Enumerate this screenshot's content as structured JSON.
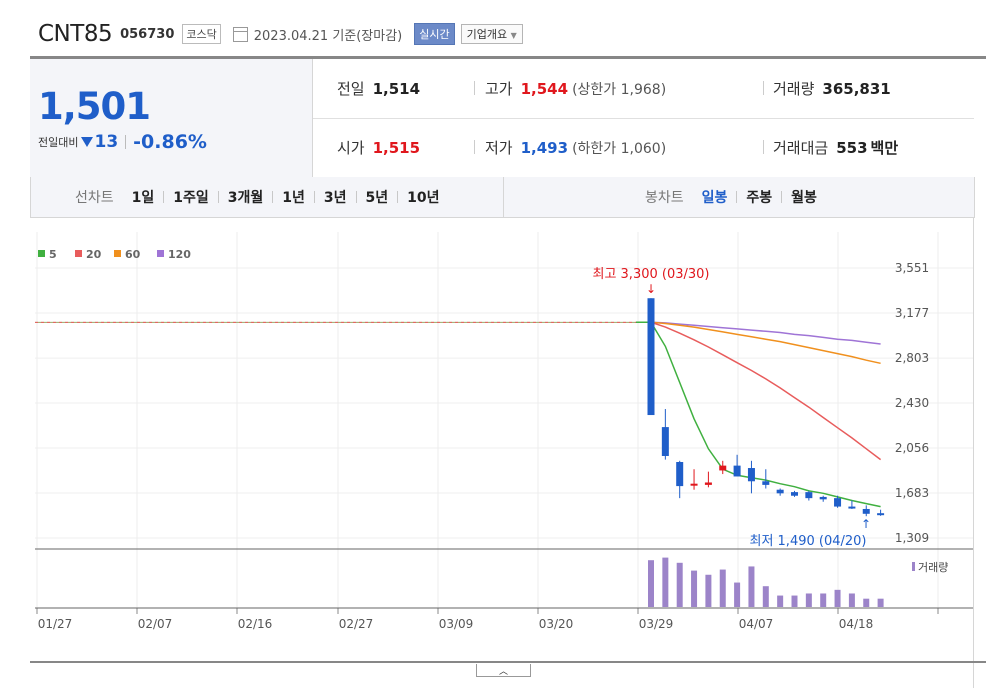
{
  "header": {
    "name": "CNT85",
    "code": "056730",
    "market": "코스닥",
    "date": "2023.04.21 기준(장마감)",
    "realtime": "실시간",
    "company": "기업개요"
  },
  "price": {
    "current": "1,501",
    "change_label": "전일대비",
    "change": "13",
    "change_direction": "down",
    "change_pct": "-0.86%"
  },
  "quote": {
    "prev": {
      "label": "전일",
      "value": "1,514"
    },
    "open": {
      "label": "시가",
      "value": "1,515"
    },
    "high": {
      "label": "고가",
      "value": "1,544",
      "extra": "(상한가 1,968)"
    },
    "low": {
      "label": "저가",
      "value": "1,493",
      "extra": "(하한가 1,060)"
    },
    "volume": {
      "label": "거래량",
      "value": "365,831"
    },
    "amount": {
      "label": "거래대금",
      "value": "553",
      "unit": "백만"
    }
  },
  "tabs": {
    "line_label": "선차트",
    "line": [
      "1일",
      "1주일",
      "3개월",
      "1년",
      "3년",
      "5년",
      "10년"
    ],
    "candle_label": "봉차트",
    "candle": [
      "일봉",
      "주봉",
      "월봉"
    ],
    "candle_active": 0
  },
  "colors": {
    "up": "#e0171d",
    "down": "#1f5ec9",
    "ma5": "#40b040",
    "ma20": "#e85c5c",
    "ma60": "#f0901e",
    "ma120": "#9f74d6",
    "volume": "#9c84c9"
  },
  "chart_data": {
    "type": "candlestick",
    "legend": [
      "5",
      "20",
      "60",
      "120"
    ],
    "y_ticks": [
      "3,551",
      "3,177",
      "2,803",
      "2,430",
      "2,056",
      "1,683",
      "1,309"
    ],
    "ylim": [
      1309,
      3551
    ],
    "x_ticks": [
      "01/27",
      "02/07",
      "02/16",
      "02/27",
      "03/09",
      "03/20",
      "03/29",
      "04/07",
      "04/18"
    ],
    "prior_close": 3100,
    "high_annotation": "최고 3,300 (03/30)",
    "low_annotation": "최저 1,490 (04/20)",
    "volume_label": "거래량",
    "candles": [
      {
        "date": "03/30",
        "o": 3300,
        "h": 3300,
        "l": 2330,
        "c": 2330
      },
      {
        "date": "03/31",
        "o": 2230,
        "h": 2380,
        "l": 1960,
        "c": 1990
      },
      {
        "date": "04/03",
        "o": 1940,
        "h": 1950,
        "l": 1640,
        "c": 1740
      },
      {
        "date": "04/04",
        "o": 1760,
        "h": 1880,
        "l": 1710,
        "c": 1760
      },
      {
        "date": "04/05",
        "o": 1750,
        "h": 1860,
        "l": 1730,
        "c": 1770
      },
      {
        "date": "04/06",
        "o": 1870,
        "h": 1950,
        "l": 1840,
        "c": 1910
      },
      {
        "date": "04/07",
        "o": 1910,
        "h": 2000,
        "l": 1820,
        "c": 1820
      },
      {
        "date": "04/10",
        "o": 1890,
        "h": 1950,
        "l": 1680,
        "c": 1780
      },
      {
        "date": "04/11",
        "o": 1780,
        "h": 1880,
        "l": 1720,
        "c": 1750
      },
      {
        "date": "04/12",
        "o": 1710,
        "h": 1720,
        "l": 1660,
        "c": 1680
      },
      {
        "date": "04/13",
        "o": 1690,
        "h": 1700,
        "l": 1650,
        "c": 1660
      },
      {
        "date": "04/14",
        "o": 1690,
        "h": 1700,
        "l": 1620,
        "c": 1640
      },
      {
        "date": "04/17",
        "o": 1650,
        "h": 1660,
        "l": 1610,
        "c": 1630
      },
      {
        "date": "04/18",
        "o": 1640,
        "h": 1660,
        "l": 1560,
        "c": 1570
      },
      {
        "date": "04/19",
        "o": 1570,
        "h": 1620,
        "l": 1550,
        "c": 1560
      },
      {
        "date": "04/20",
        "o": 1550,
        "h": 1580,
        "l": 1490,
        "c": 1510
      },
      {
        "date": "04/21",
        "o": 1515,
        "h": 1544,
        "l": 1493,
        "c": 1501
      }
    ],
    "volume": [
      90,
      95,
      85,
      70,
      62,
      72,
      47,
      78,
      40,
      22,
      22,
      26,
      26,
      33,
      26,
      16,
      16
    ],
    "ma5": [
      3100,
      2900,
      2600,
      2300,
      2050,
      1880,
      1830,
      1810,
      1790,
      1760,
      1735,
      1700,
      1680,
      1650,
      1620,
      1595,
      1570
    ],
    "ma20": [
      3100,
      3060,
      3010,
      2955,
      2895,
      2830,
      2765,
      2700,
      2630,
      2555,
      2475,
      2395,
      2310,
      2225,
      2140,
      2050,
      1960
    ],
    "ma60": [
      3100,
      3090,
      3075,
      3060,
      3040,
      3020,
      3000,
      2980,
      2960,
      2940,
      2915,
      2890,
      2865,
      2840,
      2815,
      2785,
      2760
    ],
    "ma120": [
      3100,
      3095,
      3085,
      3075,
      3065,
      3055,
      3045,
      3035,
      3025,
      3015,
      3000,
      2990,
      2975,
      2960,
      2950,
      2935,
      2920
    ]
  }
}
